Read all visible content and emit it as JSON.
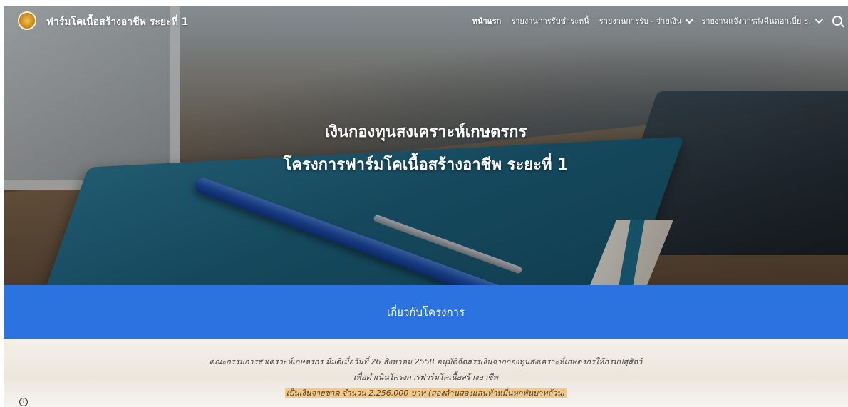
{
  "site": {
    "title": "ฟาร์มโคเนื้อสร้างอาชีพ ระยะที่ 1"
  },
  "nav": {
    "items": [
      {
        "label": "หน้าแรก",
        "active": true,
        "has_dropdown": false
      },
      {
        "label": "รายงานการรับชำระหนี้",
        "active": false,
        "has_dropdown": false
      },
      {
        "label": "รายงานการรับ - จ่ายเงิน",
        "active": false,
        "has_dropdown": true
      },
      {
        "label": "รายงานแจ้งการส่งคืนดอกเบี้ย ธ.",
        "active": false,
        "has_dropdown": true
      }
    ],
    "search_icon": "search-icon"
  },
  "hero": {
    "line1": "เงินกองทุนสงเคราะห์เกษตรกร",
    "line2": "โครงการฟาร์มโคเนื้อสร้างอาชีพ ระยะที่ 1"
  },
  "about": {
    "title": "เกี่ยวกับโครงการ",
    "bg_color": "#2c73e0"
  },
  "info": {
    "line1": "คณะกรรมการสงเคราะห์เกษตรกร มีมติเมื่อวันที่ 26 สิงหาคม 2558 อนุมัติจัดสรรเงินจากกองทุนสงเคราะห์เกษตรกรให้กรมปศุสัตว์",
    "line2": "เพื่อดำเนินโครงการฟาร์มโคเนื้อสร้างอาชีพ",
    "line3": "เป็นเงินจ่ายขาด จำนวน 2,256,000 บาท (สองล้านสองแสนห้าหมื่นหกพันบาทถ้วน)",
    "highlight_color": "#f7c784"
  },
  "footer": {
    "info_icon": "info-icon",
    "info_glyph": "i"
  }
}
